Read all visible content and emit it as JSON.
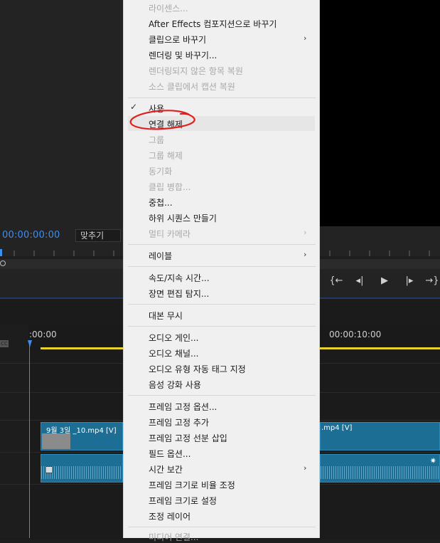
{
  "source": {
    "timecode": "00:00:00:00",
    "fit_label": "맞추기"
  },
  "timeline": {
    "tc_start": ":00:00",
    "tc_mid": "00:00:10:00",
    "video_clip_left": "9월 3일 _10.mp4 [V]",
    "video_clip_right": ".mp4 [V]",
    "cc_badge": "CC"
  },
  "transport": {
    "step_back_label": "{←",
    "frame_back_label": "◂|",
    "play_label": "▶",
    "frame_fwd_label": "|▸",
    "step_fwd_label": "→}"
  },
  "menu": {
    "items": [
      {
        "label": "라이센스...",
        "enabled": false
      },
      {
        "label": "After Effects 컴포지션으로 바꾸기",
        "enabled": true
      },
      {
        "label": "클립으로 바꾸기",
        "enabled": true,
        "submenu": true
      },
      {
        "label": "렌더링 및 바꾸기...",
        "enabled": true
      },
      {
        "label": "렌더링되지 않은 항목 복원",
        "enabled": false
      },
      {
        "label": "소스 클립에서 캡션 복원",
        "enabled": false
      },
      {
        "label": "사용",
        "enabled": true,
        "checked": true
      },
      {
        "label": "연결 해제",
        "enabled": true,
        "hovered": true
      },
      {
        "label": "그룹",
        "enabled": false
      },
      {
        "label": "그룹 해제",
        "enabled": false
      },
      {
        "label": "동기화",
        "enabled": false
      },
      {
        "label": "클립 병합...",
        "enabled": false
      },
      {
        "label": "중첩...",
        "enabled": true
      },
      {
        "label": "하위 시퀀스 만들기",
        "enabled": true
      },
      {
        "label": "멀티 카메라",
        "enabled": false,
        "submenu": true
      },
      {
        "label": "레이블",
        "enabled": true,
        "submenu": true
      },
      {
        "label": "속도/지속 시간...",
        "enabled": true
      },
      {
        "label": "장면 편집 탐지...",
        "enabled": true
      },
      {
        "label": "대본 무시",
        "enabled": true
      },
      {
        "label": "오디오 게인...",
        "enabled": true
      },
      {
        "label": "오디오 채널...",
        "enabled": true
      },
      {
        "label": "오디오 유형 자동 태그 지정",
        "enabled": true
      },
      {
        "label": "음성 강화 사용",
        "enabled": true
      },
      {
        "label": "프레임 고정 옵션...",
        "enabled": true
      },
      {
        "label": "프레임 고정 추가",
        "enabled": true
      },
      {
        "label": "프레임 고정 선분 삽입",
        "enabled": true
      },
      {
        "label": "필드 옵션...",
        "enabled": true
      },
      {
        "label": "시간 보간",
        "enabled": true,
        "submenu": true
      },
      {
        "label": "프레임 크기로 비율 조정",
        "enabled": true
      },
      {
        "label": "프레임 크기로 설정",
        "enabled": true
      },
      {
        "label": "조정 레이어",
        "enabled": true
      },
      {
        "label": "미디어 연결...",
        "enabled": false
      }
    ],
    "submenu_glyph": "›",
    "check_glyph": "✓"
  },
  "colors": {
    "accent_blue": "#3d8ef0",
    "clip_blue": "#1c6e95",
    "menu_bg": "#f0f0f0",
    "annotation_red": "#e02020",
    "work_area_yellow": "#e8d22a"
  }
}
